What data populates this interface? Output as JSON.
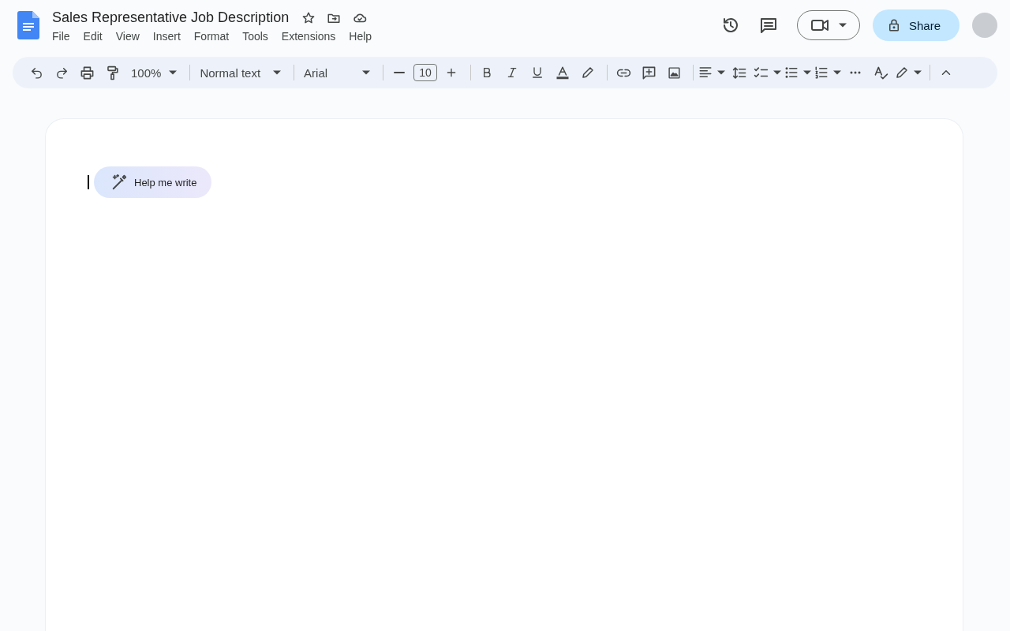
{
  "document": {
    "title": "Sales Representative Job Description"
  },
  "menu": [
    "File",
    "Edit",
    "View",
    "Insert",
    "Format",
    "Tools",
    "Extensions",
    "Help"
  ],
  "share_button": {
    "label": "Share"
  },
  "toolbar": {
    "zoom": "100%",
    "paragraph_style": "Normal text",
    "font": "Arial",
    "font_size": "10"
  },
  "help_me_write": {
    "label": "Help me write"
  }
}
